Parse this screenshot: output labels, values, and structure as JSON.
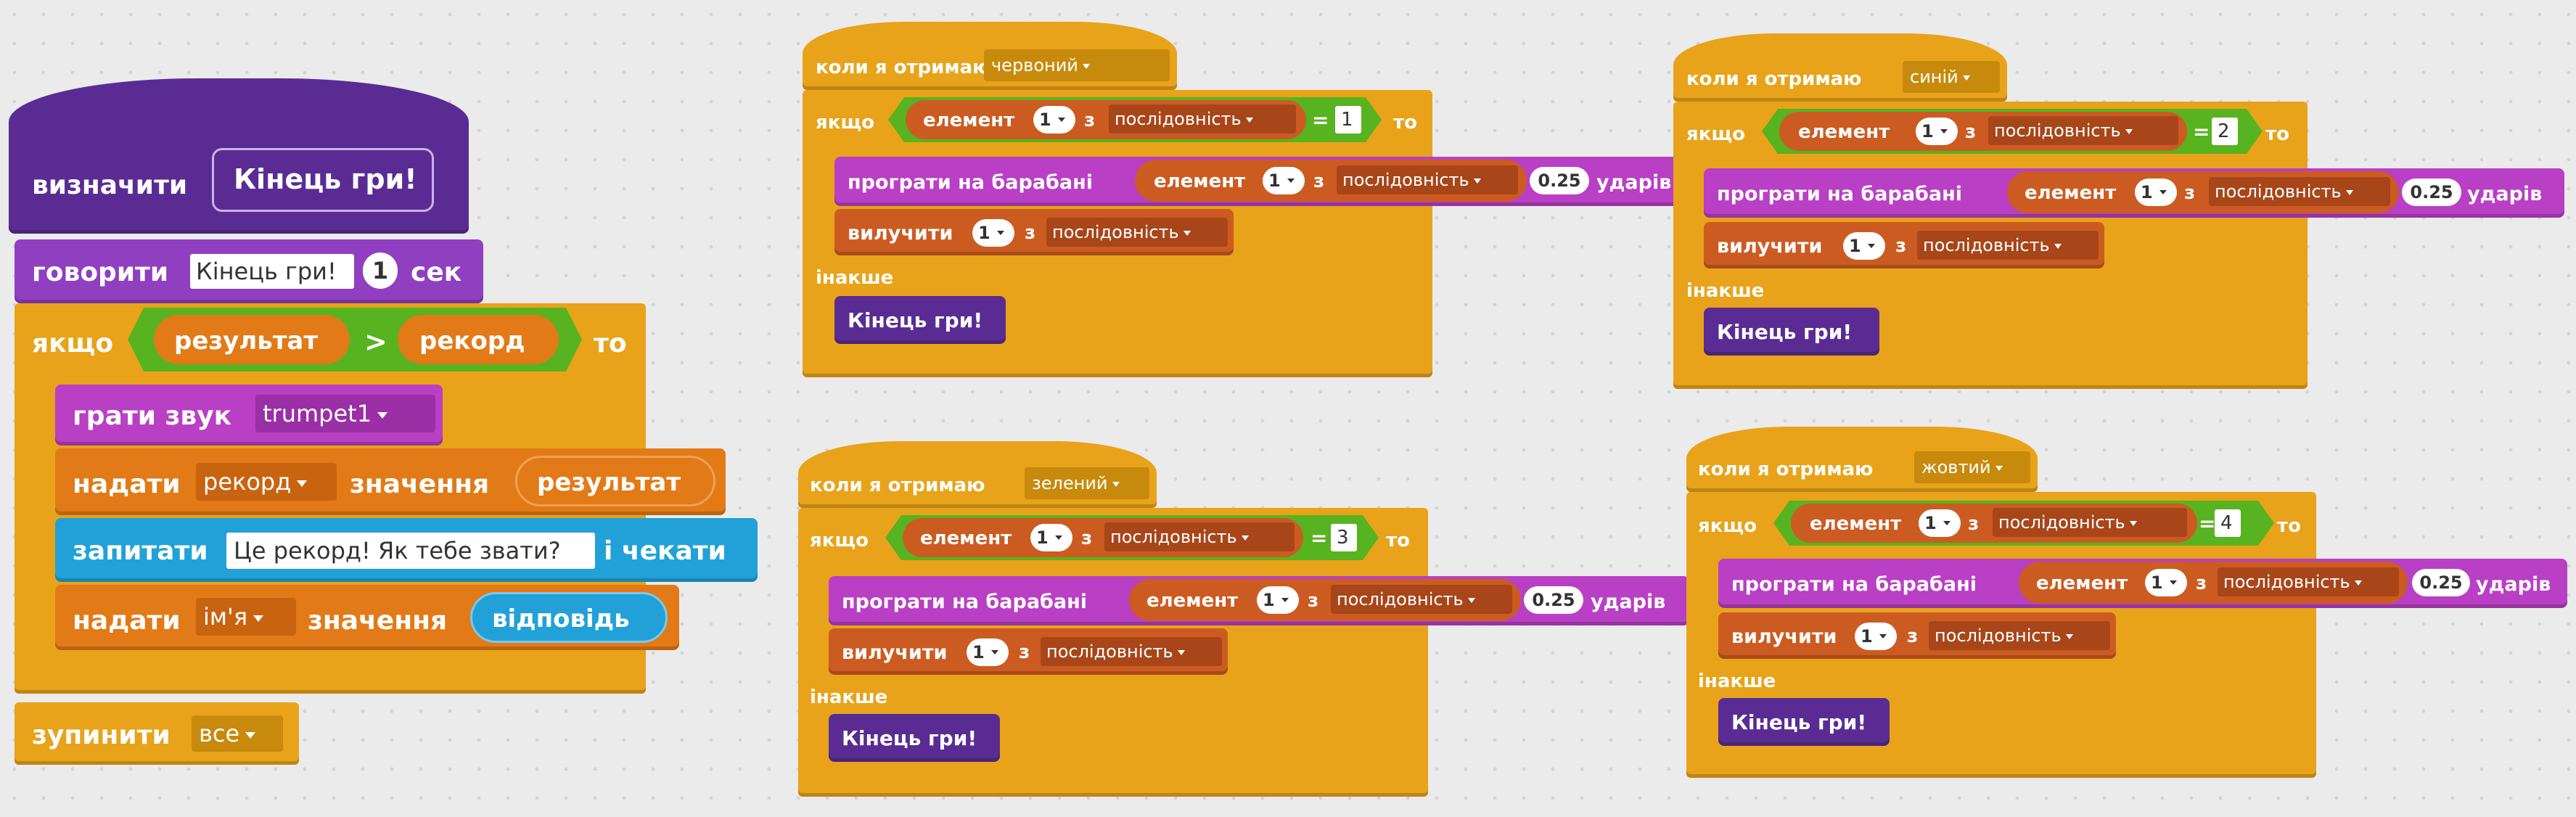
{
  "define_script": {
    "define_label": "визначити",
    "proc_name": "Кінець гри!",
    "say_label": "говорити",
    "say_text": "Кінець гри!",
    "say_secs": "1",
    "say_unit": "сек",
    "if_label": "якщо",
    "then_label": "то",
    "var_score": "результат",
    "gt_op": ">",
    "var_record": "рекорд",
    "play_sound_label": "грати звук",
    "sound_name": "trumpet1",
    "set_label": "надати",
    "set_var1": "рекорд",
    "value_label": "значення",
    "set_value1": "результат",
    "ask_label": "запитати",
    "ask_text": "Це рекорд! Як тебе звати?",
    "ask_wait": "і чекати",
    "set_var2": "ім'я",
    "set_value2": "відповідь",
    "stop_label": "зупинити",
    "stop_option": "все"
  },
  "scripts": [
    {
      "when_label": "коли я отримаю",
      "message": "червоний",
      "if_label": "якщо",
      "item_label": "елемент",
      "index": "1",
      "of_label": "з",
      "list_name": "послідовність",
      "eq_op": "=",
      "eq_value": "1",
      "then_label": "то",
      "drum_label": "програти на барабані",
      "beats": "0.25",
      "beats_label": "ударів",
      "delete_label": "вилучити",
      "else_label": "інакше",
      "proc_call": "Кінець гри!"
    },
    {
      "when_label": "коли я отримаю",
      "message": "синій",
      "if_label": "якщо",
      "item_label": "елемент",
      "index": "1",
      "of_label": "з",
      "list_name": "послідовність",
      "eq_op": "=",
      "eq_value": "2",
      "then_label": "то",
      "drum_label": "програти на барабані",
      "beats": "0.25",
      "beats_label": "ударів",
      "delete_label": "вилучити",
      "else_label": "інакше",
      "proc_call": "Кінець гри!"
    },
    {
      "when_label": "коли я отримаю",
      "message": "зелений",
      "if_label": "якщо",
      "item_label": "елемент",
      "index": "1",
      "of_label": "з",
      "list_name": "послідовність",
      "eq_op": "=",
      "eq_value": "3",
      "then_label": "то",
      "drum_label": "програти на барабані",
      "beats": "0.25",
      "beats_label": "ударів",
      "delete_label": "вилучити",
      "else_label": "інакше",
      "proc_call": "Кінець гри!"
    },
    {
      "when_label": "коли я отримаю",
      "message": "жовтий",
      "if_label": "якщо",
      "item_label": "елемент",
      "index": "1",
      "of_label": "з",
      "list_name": "послідовність",
      "eq_op": "=",
      "eq_value": "4",
      "then_label": "то",
      "drum_label": "програти на барабані",
      "beats": "0.25",
      "beats_label": "ударів",
      "delete_label": "вилучити",
      "else_label": "інакше",
      "proc_call": "Кінець гри!"
    }
  ],
  "colors": {
    "events_control": "#e8a31a",
    "more_blocks": "#5a2c93",
    "looks": "#8f3fc0",
    "sound": "#b93fc4",
    "data_variables": "#e27a17",
    "data_lists": "#cc5b22",
    "operators": "#58b320",
    "sensing": "#21a1d8"
  }
}
